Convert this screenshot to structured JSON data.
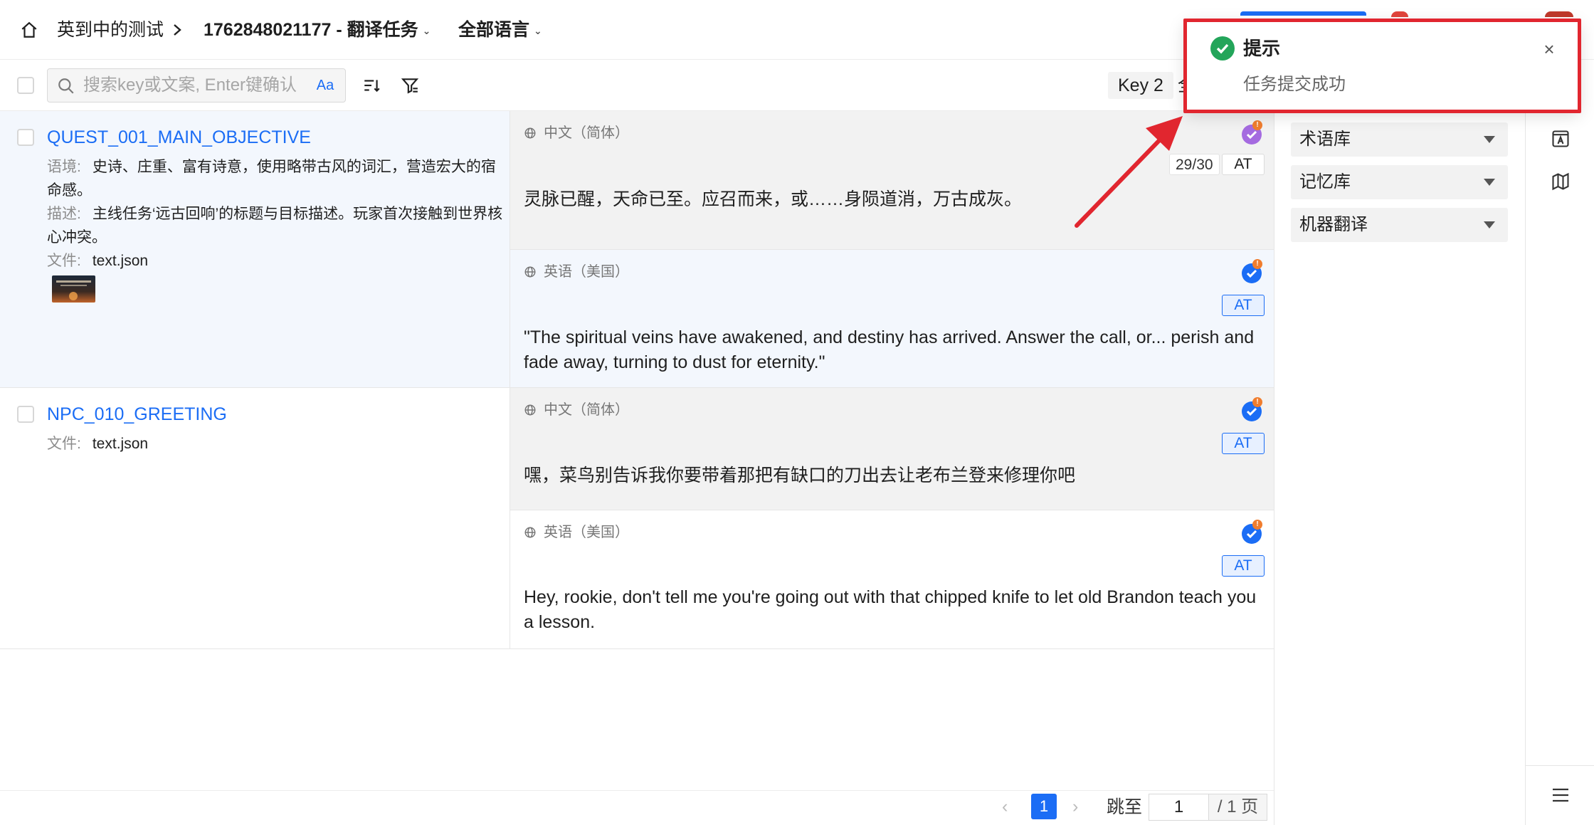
{
  "header": {
    "home_icon": "home-icon",
    "project_name": "英到中的测试",
    "task_title": "1762848021177 - 翻译任务",
    "language_filter": "全部语言"
  },
  "toolbar": {
    "search_placeholder": "搜索key或文案, Enter键确认",
    "case_toggle": "Aa",
    "key_chip": "Key 2",
    "key_chip_extra": "全"
  },
  "entries": [
    {
      "key": "QUEST_001_MAIN_OBJECTIVE",
      "context_label": "语境:",
      "context": "史诗、庄重、富有诗意，使用略带古风的词汇，营造宏大的宿命感。",
      "description_label": "描述:",
      "description": "主线任务‘远古回响’的标题与目标描述。玩家首次接触到世界核心冲突。",
      "file_label": "文件:",
      "file": "text.json",
      "source": {
        "language": "中文（简体）",
        "count": "29/30",
        "at": "AT",
        "text": "灵脉已醒，天命已至。应召而来，或……身陨道消，万古成灰。"
      },
      "target": {
        "language": "英语（美国）",
        "at": "AT",
        "text": "\"The spiritual veins have awakened, and destiny has arrived. Answer the call, or... perish and fade away, turning to dust for eternity.\""
      }
    },
    {
      "key": "NPC_010_GREETING",
      "file_label": "文件:",
      "file": "text.json",
      "source": {
        "language": "中文（简体）",
        "at": "AT",
        "text": "嘿，菜鸟别告诉我你要带着那把有缺口的刀出去让老布兰登来修理你吧"
      },
      "target": {
        "language": "英语（美国）",
        "at": "AT",
        "text": "Hey, rookie, don't tell me you're going out with that chipped knife to let old Brandon teach you a lesson."
      }
    }
  ],
  "pagination": {
    "current_page": "1",
    "jump_label": "跳至",
    "jump_value": "1",
    "total": "/ 1 页"
  },
  "resources": {
    "termbase": "术语库",
    "memory": "记忆库",
    "machine_translation": "机器翻译"
  },
  "toast": {
    "title": "提示",
    "message": "任务提交成功"
  },
  "colors": {
    "accent": "#1b6df5",
    "success": "#23a55a",
    "highlight": "#e1262f",
    "warning_dot": "#f07d2e",
    "confirm_purple": "#a56be0"
  }
}
